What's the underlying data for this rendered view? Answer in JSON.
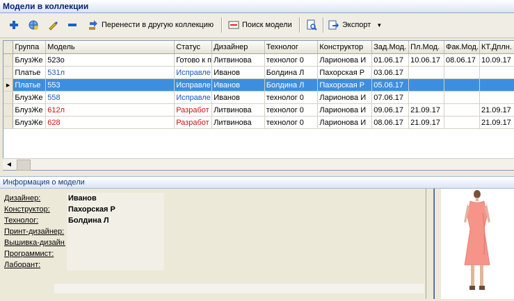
{
  "window": {
    "title": "Модели в коллекции"
  },
  "toolbar": {
    "add_icon": "plus-icon",
    "copy_icon": "globe-add-icon",
    "edit_icon": "pencil-icon",
    "remove_icon": "minus-icon",
    "move_label": "Перенести в другую коллекцию",
    "search_label": "Поиск модели",
    "preview_icon": "print-preview-icon",
    "export_label": "Экспорт"
  },
  "grid": {
    "columns": [
      "Группа",
      "Модель",
      "Статус",
      "Дизайнер",
      "Технолог",
      "Конструктор",
      "Зад.Мод.",
      "Пл.Мод.",
      "Фак.Мод.",
      "КТ.Дплн."
    ],
    "rows": [
      {
        "cells": [
          "БлузЖе",
          "523о",
          "Готово к п",
          "Литвинова",
          "технолог 0",
          "Ларионова И",
          "01.06.17",
          "10.06.17",
          "08.06.17",
          "10.09.17"
        ],
        "color": "",
        "selected": false
      },
      {
        "cells": [
          "Платье",
          "531л",
          "Исправле",
          "Иванов",
          "Болдина Л",
          "Пахорская Р",
          "03.06.17",
          "",
          "",
          ""
        ],
        "color": "blue",
        "selected": false
      },
      {
        "cells": [
          "Платье",
          "553",
          "Исправле",
          "Иванов",
          "Болдина Л",
          "Пахорская Р",
          "05.06.17",
          "",
          "",
          ""
        ],
        "color": "blue",
        "selected": true
      },
      {
        "cells": [
          "БлузЖе",
          "558",
          "Исправле",
          "Иванов",
          "технолог 0",
          "Ларионова И",
          "07.06.17",
          "",
          "",
          ""
        ],
        "color": "blue",
        "selected": false
      },
      {
        "cells": [
          "БлузЖе",
          "612л",
          "Разработ",
          "Литвинова",
          "технолог 0",
          "Ларионова И",
          "09.06.17",
          "21.09.17",
          "",
          "21.09.17"
        ],
        "color": "red",
        "selected": false
      },
      {
        "cells": [
          "БлузЖе",
          "628",
          "Разработ",
          "Литвинова",
          "технолог 0",
          "Ларионова И",
          "08.06.17",
          "21.09.17",
          "",
          "21.09.17"
        ],
        "color": "red",
        "selected": false
      }
    ]
  },
  "info": {
    "title": "Информация о модели",
    "rows": [
      {
        "label": "Дизайнер:",
        "value": "Иванов"
      },
      {
        "label": "Конструктор:",
        "value": "Пахорская Р"
      },
      {
        "label": "Технолог:",
        "value": "Болдина Л"
      },
      {
        "label": "Принт-дизайнер:",
        "value": ""
      },
      {
        "label": "Вышивка-дизайн.",
        "value": ""
      },
      {
        "label": "Программист:",
        "value": ""
      },
      {
        "label": "Лаборант:",
        "value": ""
      }
    ]
  },
  "colors": {
    "selection": "#3D8EE0",
    "status_blue": "#1B54C4",
    "status_red": "#D01010",
    "dress": "#F6948A"
  }
}
